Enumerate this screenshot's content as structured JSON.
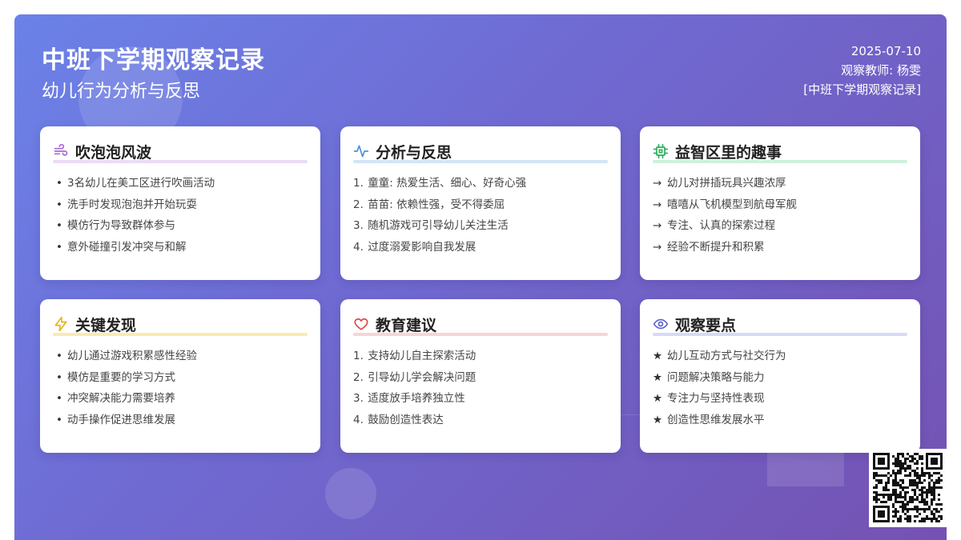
{
  "header": {
    "title": "中班下学期观察记录",
    "subtitle": "幼儿行为分析与反思",
    "date": "2025-07-10",
    "teacher": "观察教师: 杨雯",
    "tag": "[中班下学期观察记录]"
  },
  "cards": {
    "c1": {
      "icon": "wind-icon",
      "color": "#a56ad8",
      "title": "吹泡泡风波",
      "items": [
        "3名幼儿在美工区进行吹画活动",
        "洗手时发现泡泡并开始玩耍",
        "模仿行为导致群体参与",
        "意外碰撞引发冲突与和解"
      ]
    },
    "c2": {
      "icon": "activity-icon",
      "color": "#4a90d9",
      "title": "分析与反思",
      "items": [
        "童童: 热爱生活、细心、好奇心强",
        "苗苗: 依赖性强，受不得委屈",
        "随机游戏可引导幼儿关注生活",
        "过度溺爱影响自我发展"
      ]
    },
    "c3": {
      "icon": "chip-icon",
      "color": "#2fae5c",
      "title": "益智区里的趣事",
      "items": [
        "幼儿对拼插玩具兴趣浓厚",
        "嘻嘻从飞机模型到航母军舰",
        "专注、认真的探索过程",
        "经验不断提升和积累"
      ]
    },
    "c4": {
      "icon": "lightning-icon",
      "color": "#e5b318",
      "title": "关键发现",
      "items": [
        "幼儿通过游戏积累感性经验",
        "模仿是重要的学习方式",
        "冲突解决能力需要培养",
        "动手操作促进思维发展"
      ]
    },
    "c5": {
      "icon": "heart-icon",
      "color": "#e04848",
      "title": "教育建议",
      "items": [
        "支持幼儿自主探索活动",
        "引导幼儿学会解决问题",
        "适度放手培养独立性",
        "鼓励创造性表达"
      ]
    },
    "c6": {
      "icon": "eye-icon",
      "color": "#5b63c9",
      "title": "观察要点",
      "items": [
        "幼儿互动方式与社交行为",
        "问题解决策略与能力",
        "专注力与坚持性表现",
        "创造性思维发展水平"
      ]
    }
  },
  "markers": {
    "arrow": "→",
    "star": "★",
    "n1": "1.",
    "n2": "2.",
    "n3": "3.",
    "n4": "4."
  }
}
